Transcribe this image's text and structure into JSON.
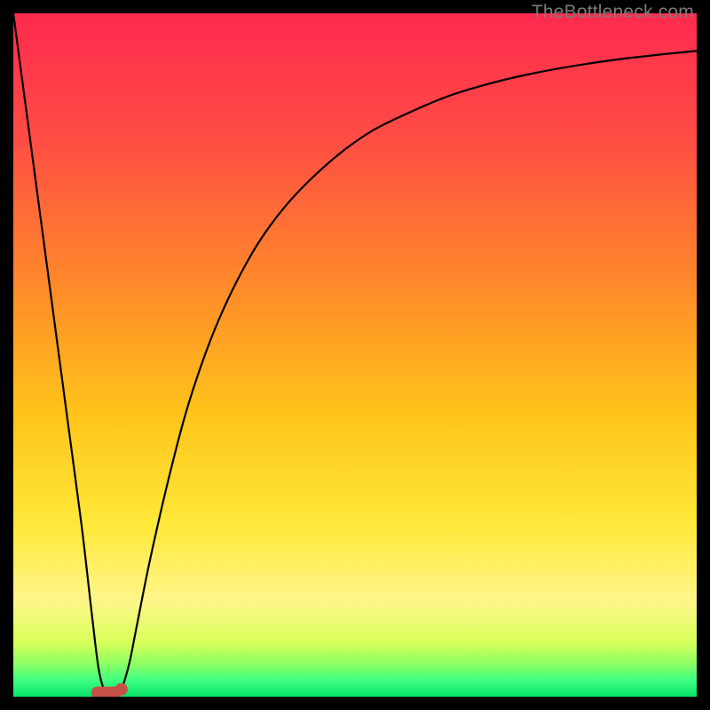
{
  "watermark": "TheBottleneck.com",
  "chart_data": {
    "type": "line",
    "title": "",
    "xlabel": "",
    "ylabel": "",
    "xlim": [
      0,
      100
    ],
    "ylim": [
      0,
      100
    ],
    "grid": false,
    "legend": false,
    "annotations": [],
    "background_gradient": {
      "stops": [
        {
          "offset": 0.0,
          "color": "#ff2a4f"
        },
        {
          "offset": 0.18,
          "color": "#ff4c44"
        },
        {
          "offset": 0.4,
          "color": "#ff8a2a"
        },
        {
          "offset": 0.58,
          "color": "#ffc21a"
        },
        {
          "offset": 0.75,
          "color": "#ffe93a"
        },
        {
          "offset": 0.86,
          "color": "#fff58a"
        },
        {
          "offset": 0.92,
          "color": "#d8ff5a"
        },
        {
          "offset": 0.95,
          "color": "#92ff62"
        },
        {
          "offset": 0.975,
          "color": "#42ff80"
        },
        {
          "offset": 1.0,
          "color": "#06e36a"
        }
      ]
    },
    "series": [
      {
        "name": "bottleneck-curve",
        "color": "#000000",
        "x": [
          0.0,
          2.0,
          4.0,
          6.0,
          8.0,
          10.0,
          11.5,
          12.5,
          13.5,
          14.5,
          15.5,
          16.0,
          17.0,
          18.0,
          20.0,
          23.0,
          26.0,
          30.0,
          35.0,
          40.0,
          46.0,
          52.0,
          58.0,
          64.0,
          70.0,
          76.0,
          82.0,
          88.0,
          94.0,
          100.0
        ],
        "y": [
          100.0,
          85.0,
          70.0,
          55.0,
          40.0,
          25.0,
          12.0,
          4.0,
          0.5,
          0.2,
          0.5,
          1.5,
          5.0,
          10.0,
          20.0,
          33.0,
          44.0,
          55.0,
          65.0,
          72.0,
          78.0,
          82.5,
          85.5,
          88.0,
          89.8,
          91.2,
          92.3,
          93.2,
          93.9,
          94.5
        ]
      }
    ],
    "marker": {
      "name": "optimal-point",
      "x": 14.0,
      "y": 0.7,
      "color": "#c6504a"
    }
  }
}
